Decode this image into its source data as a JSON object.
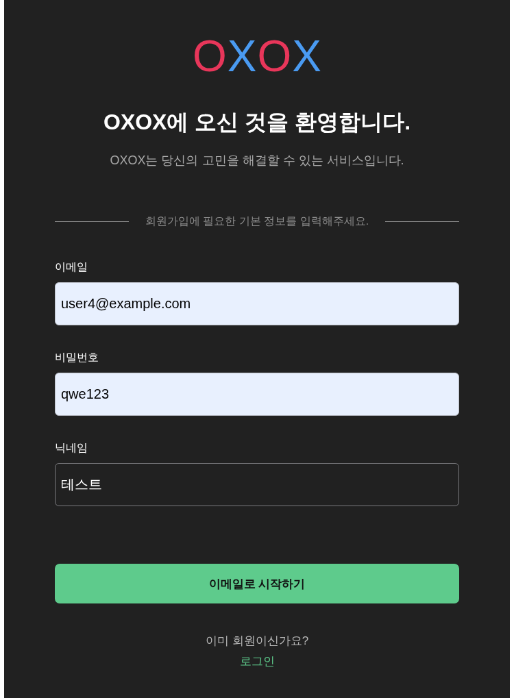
{
  "logo": {
    "letters": [
      {
        "letter": "O",
        "color": "#e8365a"
      },
      {
        "letter": "X",
        "color": "#4a9bf2"
      },
      {
        "letter": "O",
        "color": "#e8365a"
      },
      {
        "letter": "X",
        "color": "#4a9bf2"
      }
    ]
  },
  "title": "OXOX에 오신 것을 환영합니다.",
  "subtitle": "OXOX는 당신의 고민을 해결할 수 있는 서비스입니다.",
  "divider": {
    "text": "회원가입에 필요한 기본 정보를 입력해주세요."
  },
  "fields": [
    {
      "label": "이메일",
      "value": "user4@example.com",
      "autofilled": true
    },
    {
      "label": "비밀번호",
      "value": "qwe123",
      "autofilled": true
    },
    {
      "label": "닉네임",
      "value": "테스트",
      "autofilled": false
    }
  ],
  "submit_button": {
    "label": "이메일로 시작하기"
  },
  "footer": {
    "prompt": "이미 회원이신가요?",
    "link": "로그인"
  }
}
